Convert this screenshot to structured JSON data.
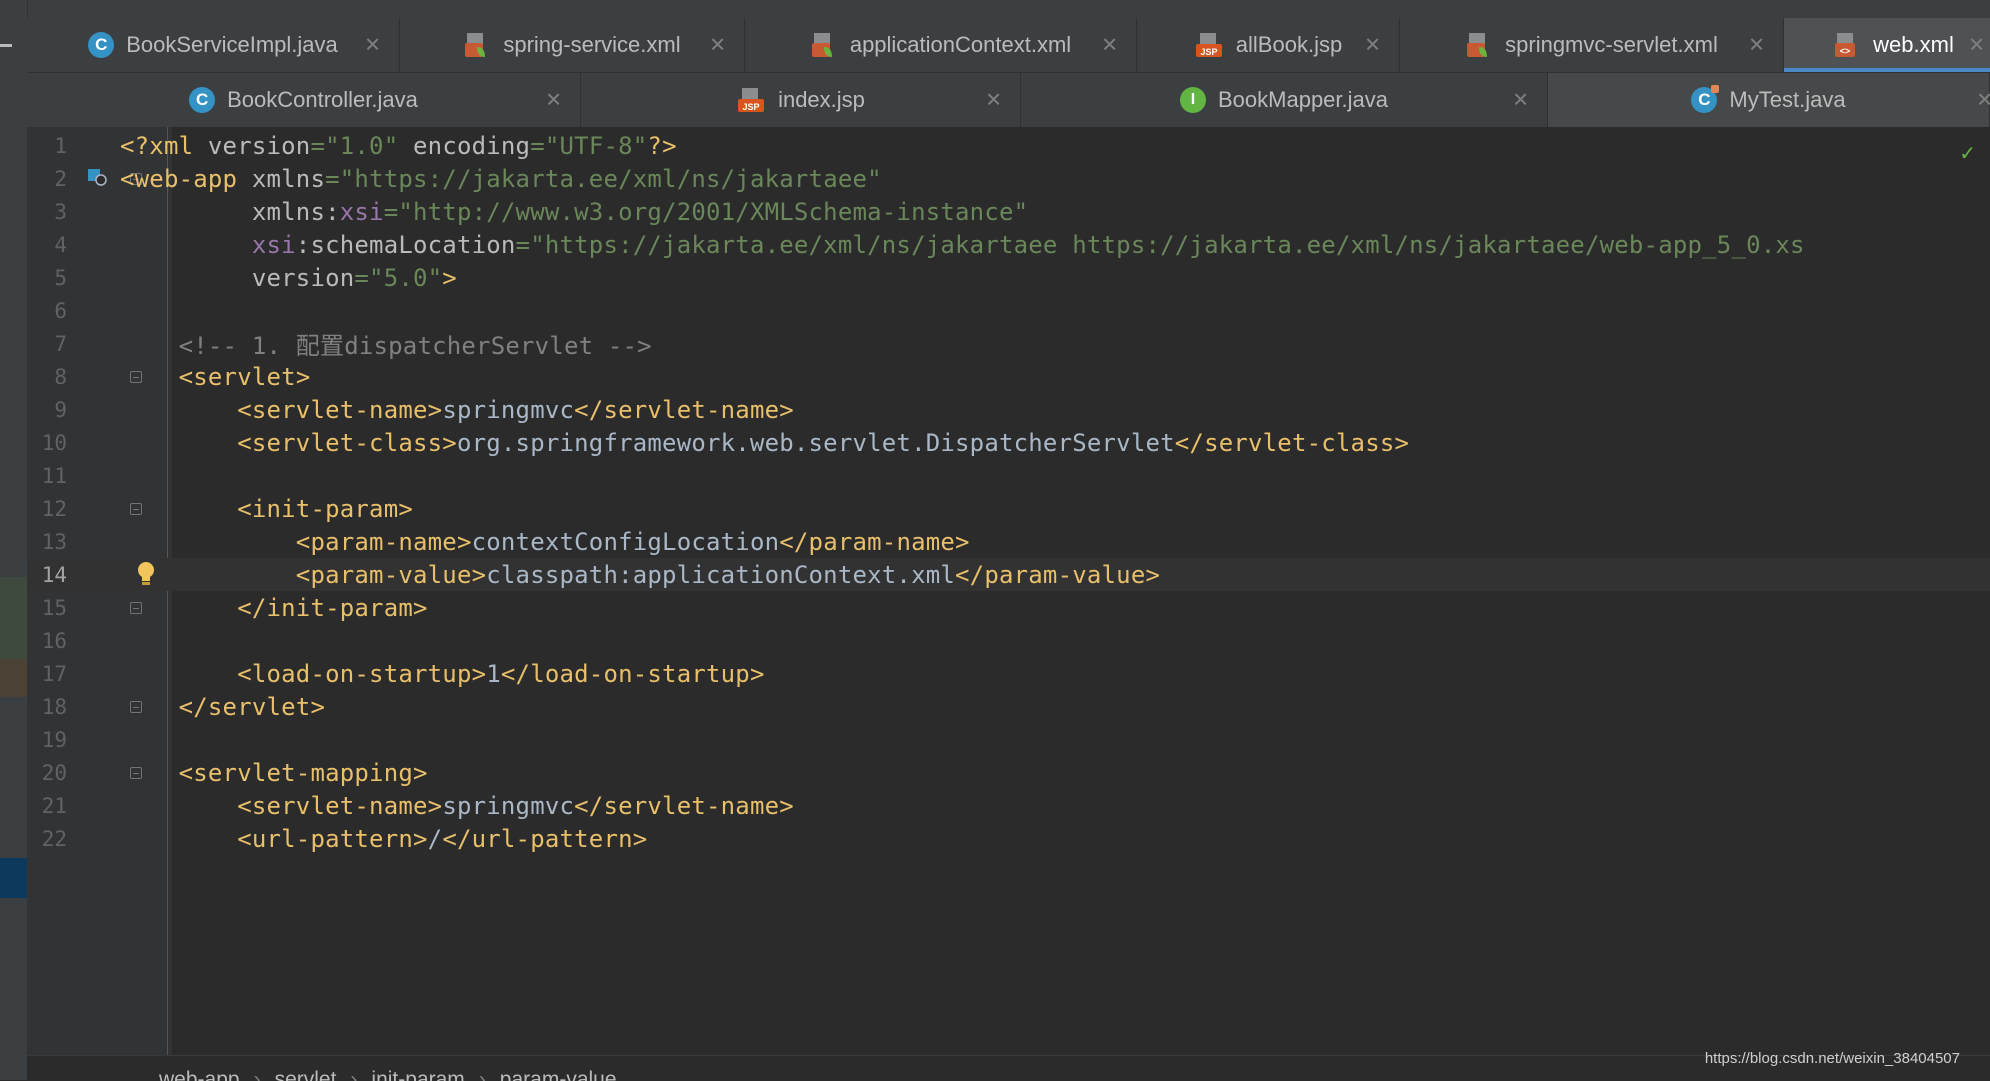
{
  "tabs_row1": [
    {
      "label": "BookServiceImpl.java",
      "icon": "class-icon",
      "active": false
    },
    {
      "label": "spring-service.xml",
      "icon": "spring-xml-icon",
      "active": false
    },
    {
      "label": "applicationContext.xml",
      "icon": "spring-xml-icon",
      "active": false
    },
    {
      "label": "allBook.jsp",
      "icon": "jsp-icon",
      "active": false
    },
    {
      "label": "springmvc-servlet.xml",
      "icon": "spring-xml-icon",
      "active": false
    },
    {
      "label": "web.xml",
      "icon": "xml-icon",
      "active": true
    }
  ],
  "tabs_row2": [
    {
      "label": "BookController.java",
      "icon": "class-icon"
    },
    {
      "label": "index.jsp",
      "icon": "jsp-icon"
    },
    {
      "label": "BookMapper.java",
      "icon": "interface-icon"
    },
    {
      "label": "MyTest.java",
      "icon": "test-class-icon"
    }
  ],
  "editor": {
    "current_line": 14,
    "lines": [
      {
        "n": "1",
        "code": "<?xml version=\"1.0\" encoding=\"UTF-8\"?>"
      },
      {
        "n": "2",
        "code": "<web-app xmlns=\"https://jakarta.ee/xml/ns/jakartaee\""
      },
      {
        "n": "3",
        "code": "         xmlns:xsi=\"http://www.w3.org/2001/XMLSchema-instance\""
      },
      {
        "n": "4",
        "code": "         xsi:schemaLocation=\"https://jakarta.ee/xml/ns/jakartaee https://jakarta.ee/xml/ns/jakartaee/web-app_5_0.xs"
      },
      {
        "n": "5",
        "code": "         version=\"5.0\">"
      },
      {
        "n": "6",
        "code": ""
      },
      {
        "n": "7",
        "code": "    <!-- 1. 配置dispatcherServlet -->"
      },
      {
        "n": "8",
        "code": "    <servlet>"
      },
      {
        "n": "9",
        "code": "        <servlet-name>springmvc</servlet-name>"
      },
      {
        "n": "10",
        "code": "        <servlet-class>org.springframework.web.servlet.DispatcherServlet</servlet-class>"
      },
      {
        "n": "11",
        "code": ""
      },
      {
        "n": "12",
        "code": "        <init-param>"
      },
      {
        "n": "13",
        "code": "            <param-name>contextConfigLocation</param-name>"
      },
      {
        "n": "14",
        "code": "            <param-value>classpath:applicationContext.xml</param-value>"
      },
      {
        "n": "15",
        "code": "        </init-param>"
      },
      {
        "n": "16",
        "code": ""
      },
      {
        "n": "17",
        "code": "        <load-on-startup>1</load-on-startup>"
      },
      {
        "n": "18",
        "code": "    </servlet>"
      },
      {
        "n": "19",
        "code": ""
      },
      {
        "n": "20",
        "code": "    <servlet-mapping>"
      },
      {
        "n": "21",
        "code": "        <servlet-name>springmvc</servlet-name>"
      },
      {
        "n": "22",
        "code": "        <url-pattern>/</url-pattern>"
      }
    ]
  },
  "breadcrumb": [
    "web-app",
    "servlet",
    "init-param",
    "param-value"
  ],
  "watermark": "https://blog.csdn.net/weixin_38404507",
  "colors": {
    "tag": "#e8bf6a",
    "string": "#6a8759",
    "comment": "#808080",
    "namespace": "#9876aa",
    "accent": "#4a88c7"
  }
}
